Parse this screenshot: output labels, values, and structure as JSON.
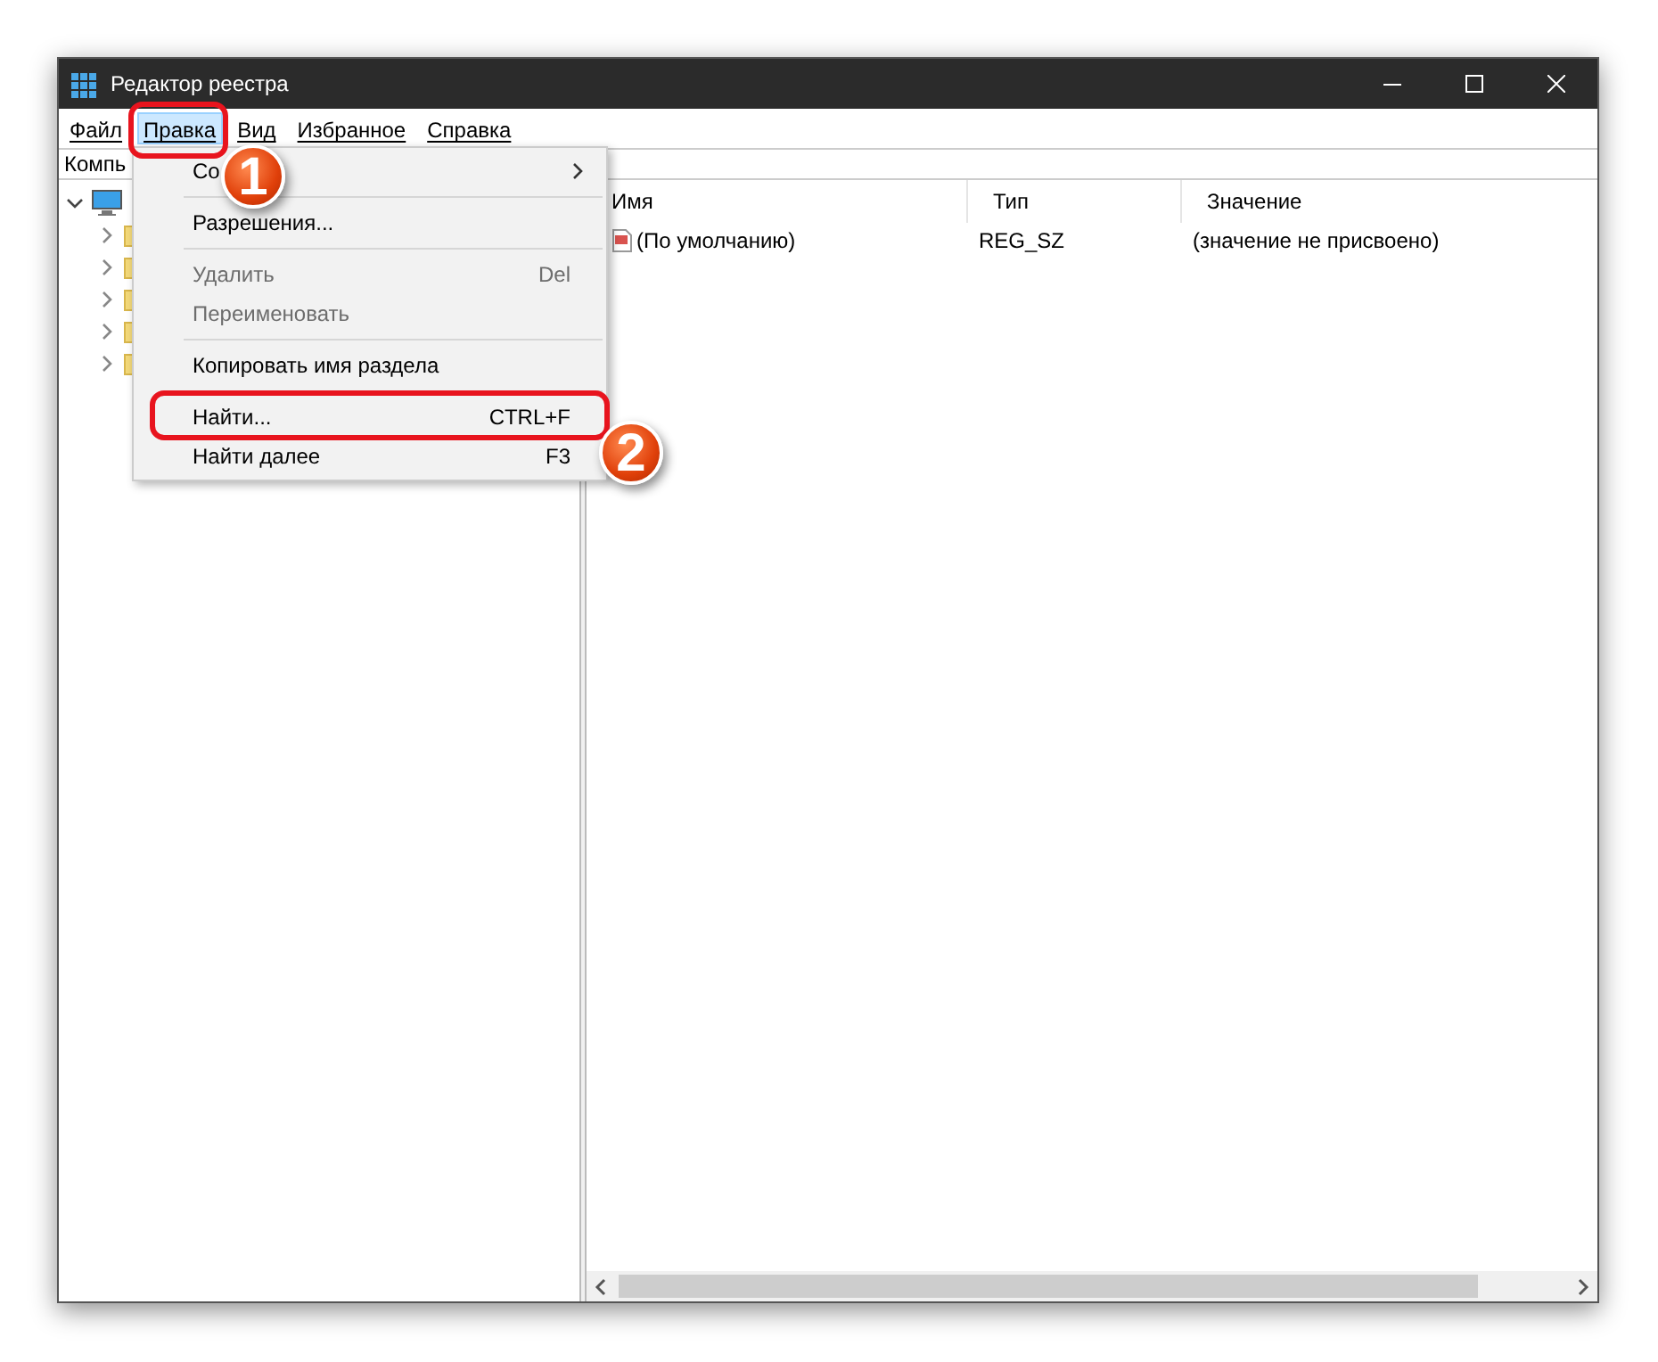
{
  "window": {
    "title": "Редактор реестра"
  },
  "menu": [
    {
      "label": "Файл",
      "selected": false
    },
    {
      "label": "Правка",
      "selected": true
    },
    {
      "label": "Вид",
      "selected": false
    },
    {
      "label": "Избранное",
      "selected": false
    },
    {
      "label": "Справка",
      "selected": false
    }
  ],
  "address": "Компь",
  "tree": {
    "expanded": true,
    "children": [
      {
        "expanded": false
      },
      {
        "expanded": false
      },
      {
        "expanded": false
      },
      {
        "expanded": false
      },
      {
        "expanded": false
      }
    ]
  },
  "table": {
    "columns": [
      "Имя",
      "Тип",
      "Значение"
    ],
    "rows": [
      {
        "name": "(По умолчанию)",
        "type": "REG_SZ",
        "value": "(значение не присвоено)"
      }
    ]
  },
  "dropdown": [
    {
      "kind": "item",
      "label": "Со",
      "submenu": true,
      "disabled": false
    },
    {
      "kind": "separator"
    },
    {
      "kind": "item",
      "label": "Разрешения...",
      "submenu": false,
      "disabled": false
    },
    {
      "kind": "separator"
    },
    {
      "kind": "item",
      "label": "Удалить",
      "shortcut": "Del",
      "submenu": false,
      "disabled": true
    },
    {
      "kind": "item",
      "label": "Переименовать",
      "submenu": false,
      "disabled": true
    },
    {
      "kind": "separator"
    },
    {
      "kind": "item",
      "label": "Копировать имя раздела",
      "submenu": false,
      "disabled": false
    },
    {
      "kind": "separator"
    },
    {
      "kind": "item",
      "label": "Найти...",
      "shortcut": "CTRL+F",
      "submenu": false,
      "disabled": false
    },
    {
      "kind": "item",
      "label": "Найти далее",
      "shortcut": "F3",
      "submenu": false,
      "disabled": false
    }
  ],
  "callouts": [
    {
      "number": "1"
    },
    {
      "number": "2"
    }
  ]
}
